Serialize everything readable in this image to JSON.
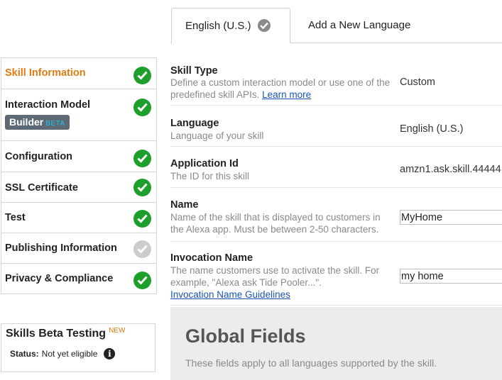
{
  "tabs": {
    "active_label": "English (U.S.)",
    "add_label": "Add a New Language"
  },
  "sidebar": {
    "items": [
      {
        "label": "Skill Information",
        "status": "complete"
      },
      {
        "label": "Interaction Model",
        "status": "complete"
      },
      {
        "label": "Configuration",
        "status": "complete"
      },
      {
        "label": "SSL Certificate",
        "status": "complete"
      },
      {
        "label": "Test",
        "status": "complete"
      },
      {
        "label": "Publishing Information",
        "status": "pending"
      },
      {
        "label": "Privacy & Compliance",
        "status": "complete"
      }
    ],
    "builder_badge": {
      "label": "Builder",
      "beta": "BETA"
    }
  },
  "beta_testing": {
    "title": "Skills Beta Testing",
    "new_badge": "NEW",
    "status_label": "Status:",
    "status_value": "Not yet eligible"
  },
  "form": {
    "skill_type": {
      "title": "Skill Type",
      "desc": "Define a custom interaction model or use one of the predefined skill APIs.",
      "link": "Learn more",
      "value": "Custom"
    },
    "language": {
      "title": "Language",
      "desc": "Language of your skill",
      "value": "English (U.S.)"
    },
    "application_id": {
      "title": "Application Id",
      "desc": "The ID for this skill",
      "value": "amzn1.ask.skill.44444"
    },
    "name": {
      "title": "Name",
      "desc": "Name of the skill that is displayed to customers in the Alexa app. Must be between 2-50 characters.",
      "value": "MyHome"
    },
    "invocation_name": {
      "title": "Invocation Name",
      "desc": "The name customers use to activate the skill. For example, \"Alexa ask Tide Pooler...\".",
      "link": "Invocation Name Guidelines",
      "value": "my home"
    }
  },
  "global_fields": {
    "title": "Global Fields",
    "desc": "These fields apply to all languages supported by the skill."
  },
  "colors": {
    "accent_orange": "#e07b14",
    "complete_green": "#1e9e2a",
    "pending_gray": "#cccccc",
    "link_blue": "#1a55b5"
  }
}
